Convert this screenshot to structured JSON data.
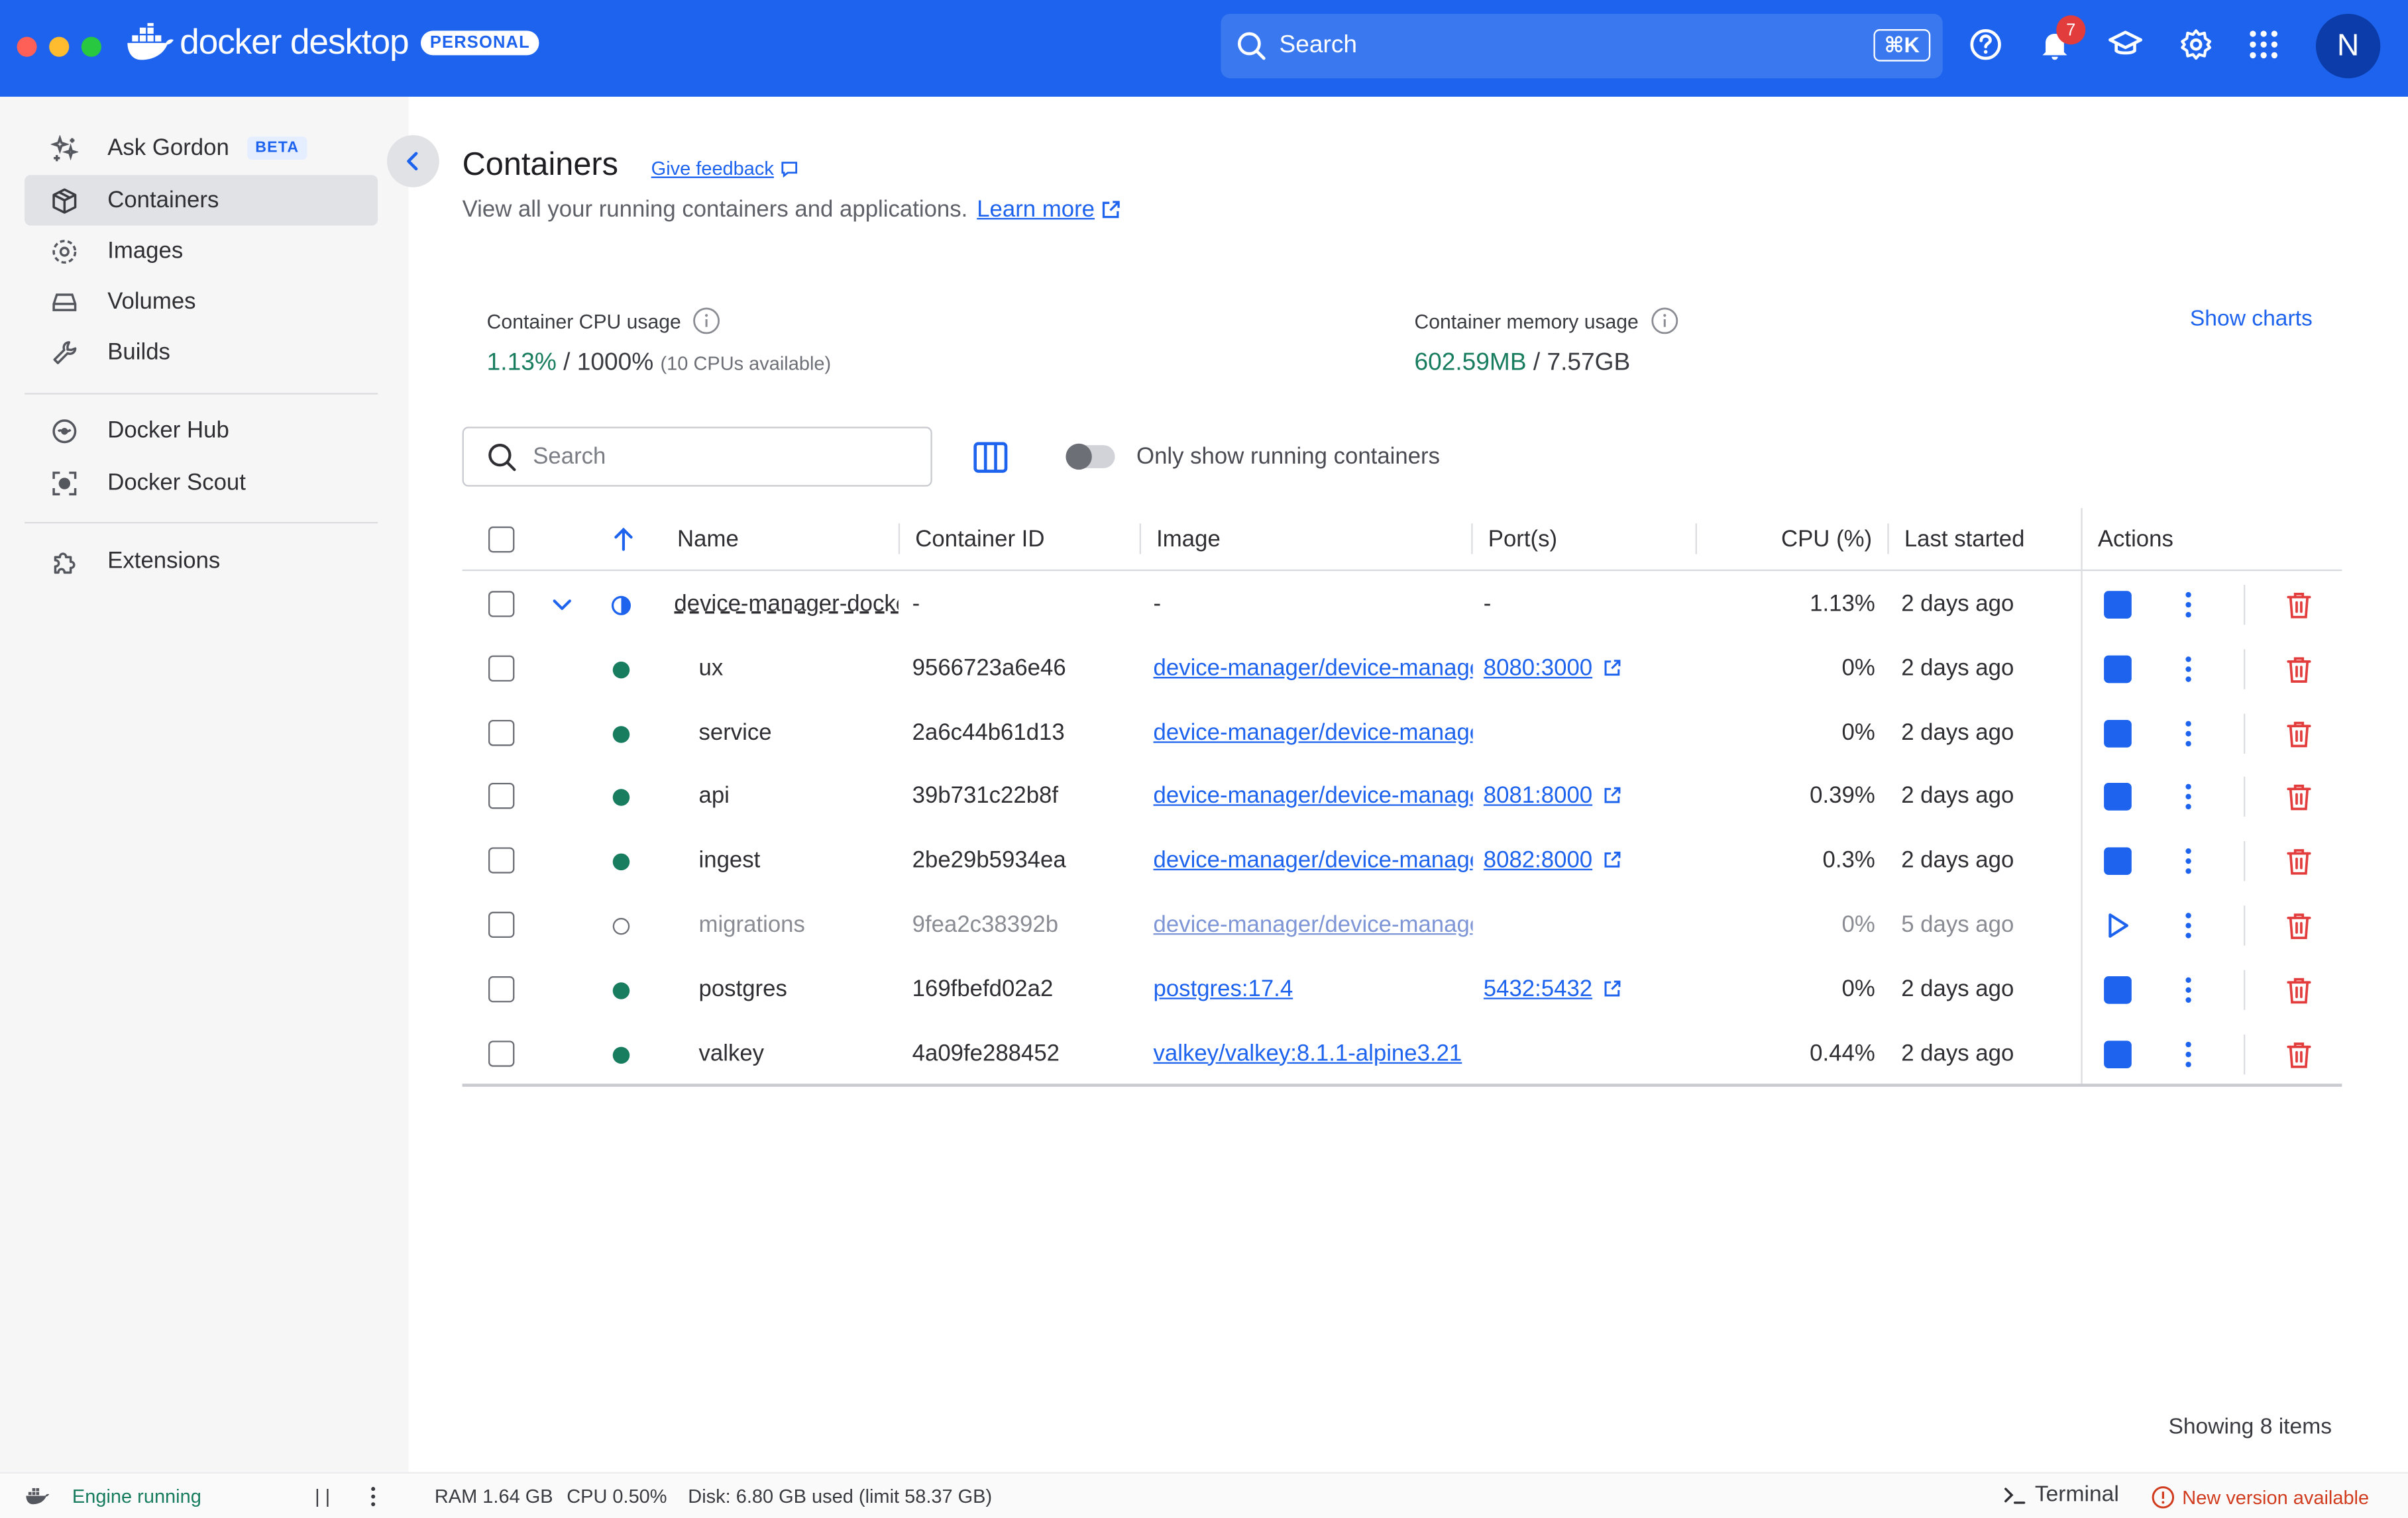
{
  "app": {
    "brand": "docker desktop",
    "plan_badge": "PERSONAL",
    "search_placeholder": "Search",
    "search_shortcut": "⌘K",
    "notifications_count": "7",
    "avatar_initial": "N",
    "colors": {
      "topbar": "#1d63ed",
      "accent": "#1d63ed",
      "running": "#187c5f",
      "danger": "#e23c3c"
    }
  },
  "sidebar": {
    "items": [
      {
        "label": "Ask Gordon",
        "badge": "BETA",
        "icon": "sparkle-icon"
      },
      {
        "label": "Containers",
        "icon": "container-icon",
        "active": true
      },
      {
        "label": "Images",
        "icon": "images-icon"
      },
      {
        "label": "Volumes",
        "icon": "volume-icon"
      },
      {
        "label": "Builds",
        "icon": "wrench-icon"
      },
      {
        "label": "Docker Hub",
        "icon": "hub-icon"
      },
      {
        "label": "Docker Scout",
        "icon": "scout-icon"
      },
      {
        "label": "Extensions",
        "icon": "puzzle-icon"
      }
    ]
  },
  "page": {
    "title": "Containers",
    "feedback": "Give feedback",
    "subtitle": "View all your running containers and applications.",
    "learn_more": "Learn more",
    "cpu_label": "Container CPU usage",
    "cpu_used": "1.13%",
    "cpu_total": " / 1000%",
    "cpu_note": "(10 CPUs available)",
    "mem_label": "Container memory usage",
    "mem_used": "602.59MB",
    "mem_total": " / 7.57GB",
    "show_charts": "Show charts",
    "search_placeholder": "Search",
    "toggle_label": "Only show running containers",
    "showing": "Showing 8 items"
  },
  "table": {
    "headers": {
      "name": "Name",
      "id": "Container ID",
      "image": "Image",
      "ports": "Port(s)",
      "cpu": "CPU (%)",
      "started": "Last started",
      "actions": "Actions"
    },
    "rows": [
      {
        "name": "device-manager-docker",
        "id": "-",
        "image": "-",
        "ports": "-",
        "cpu": "1.13%",
        "started": "2 days ago",
        "status": "group"
      },
      {
        "name": "ux",
        "id": "9566723a6e46",
        "image": "device-manager/device-manager-ux",
        "ports": "8080:3000",
        "cpu": "0%",
        "started": "2 days ago",
        "status": "running"
      },
      {
        "name": "service",
        "id": "2a6c44b61d13",
        "image": "device-manager/device-manager-service",
        "ports": "",
        "cpu": "0%",
        "started": "2 days ago",
        "status": "running"
      },
      {
        "name": "api",
        "id": "39b731c22b8f",
        "image": "device-manager/device-manager-api",
        "ports": "8081:8000",
        "cpu": "0.39%",
        "started": "2 days ago",
        "status": "running"
      },
      {
        "name": "ingest",
        "id": "2be29b5934ea",
        "image": "device-manager/device-manager-ingest",
        "ports": "8082:8000",
        "cpu": "0.3%",
        "started": "2 days ago",
        "status": "running"
      },
      {
        "name": "migrations",
        "id": "9fea2c38392b",
        "image": "device-manager/device-manager-migrations",
        "ports": "",
        "cpu": "0%",
        "started": "5 days ago",
        "status": "stopped"
      },
      {
        "name": "postgres",
        "id": "169fbefd02a2",
        "image": "postgres:17.4",
        "ports": "5432:5432",
        "cpu": "0%",
        "started": "2 days ago",
        "status": "running"
      },
      {
        "name": "valkey",
        "id": "4a09fe288452",
        "image": "valkey/valkey:8.1.1-alpine3.21",
        "ports": "",
        "cpu": "0.44%",
        "started": "2 days ago",
        "status": "running"
      }
    ]
  },
  "footer": {
    "engine": "Engine running",
    "pause": "| |",
    "ram": "RAM 1.64 GB",
    "cpu": "CPU 0.50%",
    "disk": "Disk: 6.80 GB used (limit 58.37 GB)",
    "terminal": "Terminal",
    "new_version": "New version available"
  }
}
